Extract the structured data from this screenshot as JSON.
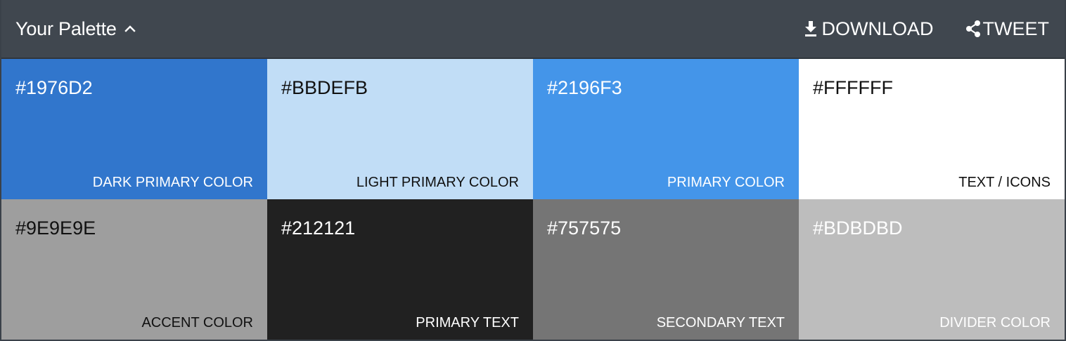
{
  "header": {
    "title": "Your Palette",
    "download_label": "DOWNLOAD",
    "tweet_label": "TWEET"
  },
  "icons": {
    "chevron": "chevron-up-icon",
    "download": "download-icon",
    "share": "share-icon"
  },
  "colors": {
    "header_bg": "#40474F",
    "frame_bg": "#3A4149"
  },
  "swatches": [
    {
      "hex": "#1976D2",
      "role": "DARK PRIMARY COLOR",
      "bg": "#3176CC",
      "fg": "#FFFFFF"
    },
    {
      "hex": "#BBDEFB",
      "role": "LIGHT PRIMARY COLOR",
      "bg": "#C1DDF6",
      "fg": "#111111"
    },
    {
      "hex": "#2196F3",
      "role": "PRIMARY COLOR",
      "bg": "#4495E9",
      "fg": "#FFFFFF"
    },
    {
      "hex": "#FFFFFF",
      "role": "TEXT / ICONS",
      "bg": "#FFFFFF",
      "fg": "#111111"
    },
    {
      "hex": "#9E9E9E",
      "role": "ACCENT COLOR",
      "bg": "#9E9E9E",
      "fg": "#111111"
    },
    {
      "hex": "#212121",
      "role": "PRIMARY TEXT",
      "bg": "#212121",
      "fg": "#FFFFFF"
    },
    {
      "hex": "#757575",
      "role": "SECONDARY TEXT",
      "bg": "#757575",
      "fg": "#FFFFFF"
    },
    {
      "hex": "#BDBDBD",
      "role": "DIVIDER COLOR",
      "bg": "#BDBDBD",
      "fg": "#FFFFFF"
    }
  ]
}
